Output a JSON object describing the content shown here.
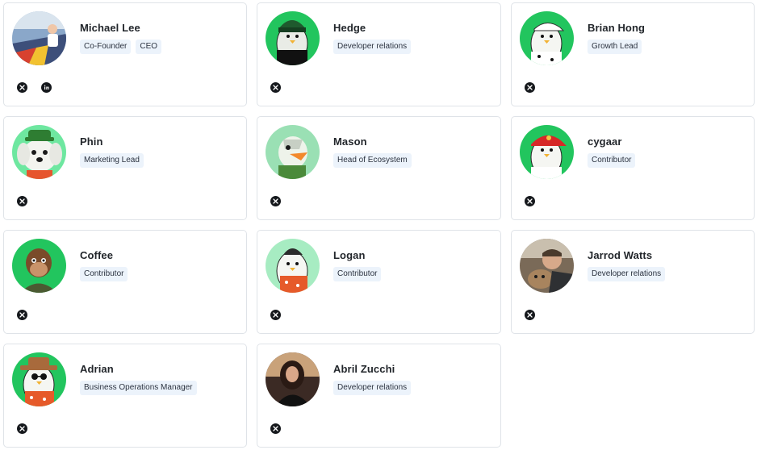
{
  "members": [
    {
      "name": "Michael Lee",
      "roles": [
        "Co-Founder",
        "CEO"
      ],
      "socials": [
        "x-icon",
        "linkedin-icon"
      ],
      "avatar": {
        "bg": "#8aa7c9",
        "style": "photo"
      }
    },
    {
      "name": "Hedge",
      "roles": [
        "Developer relations"
      ],
      "socials": [
        "x-icon"
      ],
      "avatar": {
        "bg": "#22c55e",
        "style": "penguin-green"
      }
    },
    {
      "name": "Brian Hong",
      "roles": [
        "Growth Lead"
      ],
      "socials": [
        "x-icon"
      ],
      "avatar": {
        "bg": "#22c55e",
        "style": "penguin-cap"
      }
    },
    {
      "name": "Phin",
      "roles": [
        "Marketing Lead"
      ],
      "socials": [
        "x-icon"
      ],
      "avatar": {
        "bg": "#6ee7a0",
        "style": "dog"
      }
    },
    {
      "name": "Mason",
      "roles": [
        "Head of Ecosystem"
      ],
      "socials": [
        "x-icon"
      ],
      "avatar": {
        "bg": "#9ae0b4",
        "style": "duck"
      }
    },
    {
      "name": "cygaar",
      "roles": [
        "Contributor"
      ],
      "socials": [
        "x-icon"
      ],
      "avatar": {
        "bg": "#22c55e",
        "style": "penguin-red"
      }
    },
    {
      "name": "Coffee",
      "roles": [
        "Contributor"
      ],
      "socials": [
        "x-icon"
      ],
      "avatar": {
        "bg": "#22c55e",
        "style": "ape"
      }
    },
    {
      "name": "Logan",
      "roles": [
        "Contributor"
      ],
      "socials": [
        "x-icon"
      ],
      "avatar": {
        "bg": "#a7ecc2",
        "style": "penguin-beanie"
      }
    },
    {
      "name": "Jarrod Watts",
      "roles": [
        "Developer relations"
      ],
      "socials": [
        "x-icon"
      ],
      "avatar": {
        "bg": "#7a6a58",
        "style": "photo-dog"
      }
    },
    {
      "name": "Adrian",
      "roles": [
        "Business Operations Manager"
      ],
      "socials": [
        "x-icon"
      ],
      "avatar": {
        "bg": "#22c55e",
        "style": "penguin-hat"
      }
    },
    {
      "name": "Abril Zucchi",
      "roles": [
        "Developer relations"
      ],
      "socials": [
        "x-icon"
      ],
      "avatar": {
        "bg": "#3b2a24",
        "style": "photo-person"
      }
    }
  ]
}
